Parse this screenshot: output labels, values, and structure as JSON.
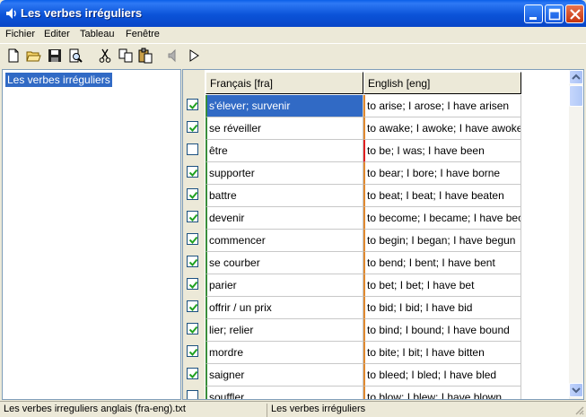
{
  "window": {
    "title": "Les verbes irréguliers"
  },
  "menu": [
    "Fichier",
    "Editer",
    "Tableau",
    "Fenêtre"
  ],
  "toolbar": {
    "icons": [
      "new-icon",
      "open-folder-icon",
      "save-icon",
      "print-preview-icon",
      "cut-icon",
      "copy-icon",
      "paste-icon",
      "speaker-icon",
      "play-icon"
    ]
  },
  "tree": {
    "root_label": "Les verbes irréguliers"
  },
  "grid": {
    "headers": {
      "fr": "Français  [fra]",
      "en": "English  [eng]"
    },
    "rows": [
      {
        "fr": "s'élever; survenir",
        "en": "to arise; I arose; I have arisen",
        "checked": true
      },
      {
        "fr": "se réveiller",
        "en": "to awake; I awoke; I have awoke",
        "checked": true
      },
      {
        "fr": "être",
        "en": "to be; I was; I have been",
        "checked": false
      },
      {
        "fr": "supporter",
        "en": "to bear; I bore; I have borne",
        "checked": true
      },
      {
        "fr": "battre",
        "en": "to beat; I beat; I have beaten",
        "checked": true
      },
      {
        "fr": "devenir",
        "en": "to become; I became; I have bec",
        "checked": true
      },
      {
        "fr": "commencer",
        "en": "to begin; I began; I have begun",
        "checked": true
      },
      {
        "fr": "se courber",
        "en": "to bend; I bent; I have bent",
        "checked": true
      },
      {
        "fr": "parier",
        "en": "to bet; I bet; I have bet",
        "checked": true
      },
      {
        "fr": "offrir / un prix",
        "en": "to bid; I bid; I have bid",
        "checked": true
      },
      {
        "fr": "lier; relier",
        "en": "to bind; I bound; I have bound",
        "checked": true
      },
      {
        "fr": "mordre",
        "en": "to bite; I bit; I have bitten",
        "checked": true
      },
      {
        "fr": "saigner",
        "en": "to bleed; I bled; I have bled",
        "checked": true
      },
      {
        "fr": "souffler",
        "en": "to blow; I blew; I have blown",
        "checked": false
      }
    ]
  },
  "status": {
    "file": "Les verbes irreguliers anglais (fra-eng).txt",
    "list": "Les verbes irréguliers"
  },
  "colors": {
    "selection": "#316ac5",
    "titlebar": "#0b53d8",
    "fr_marker": "#3a8e3a",
    "en_marker": "#e08a30"
  }
}
